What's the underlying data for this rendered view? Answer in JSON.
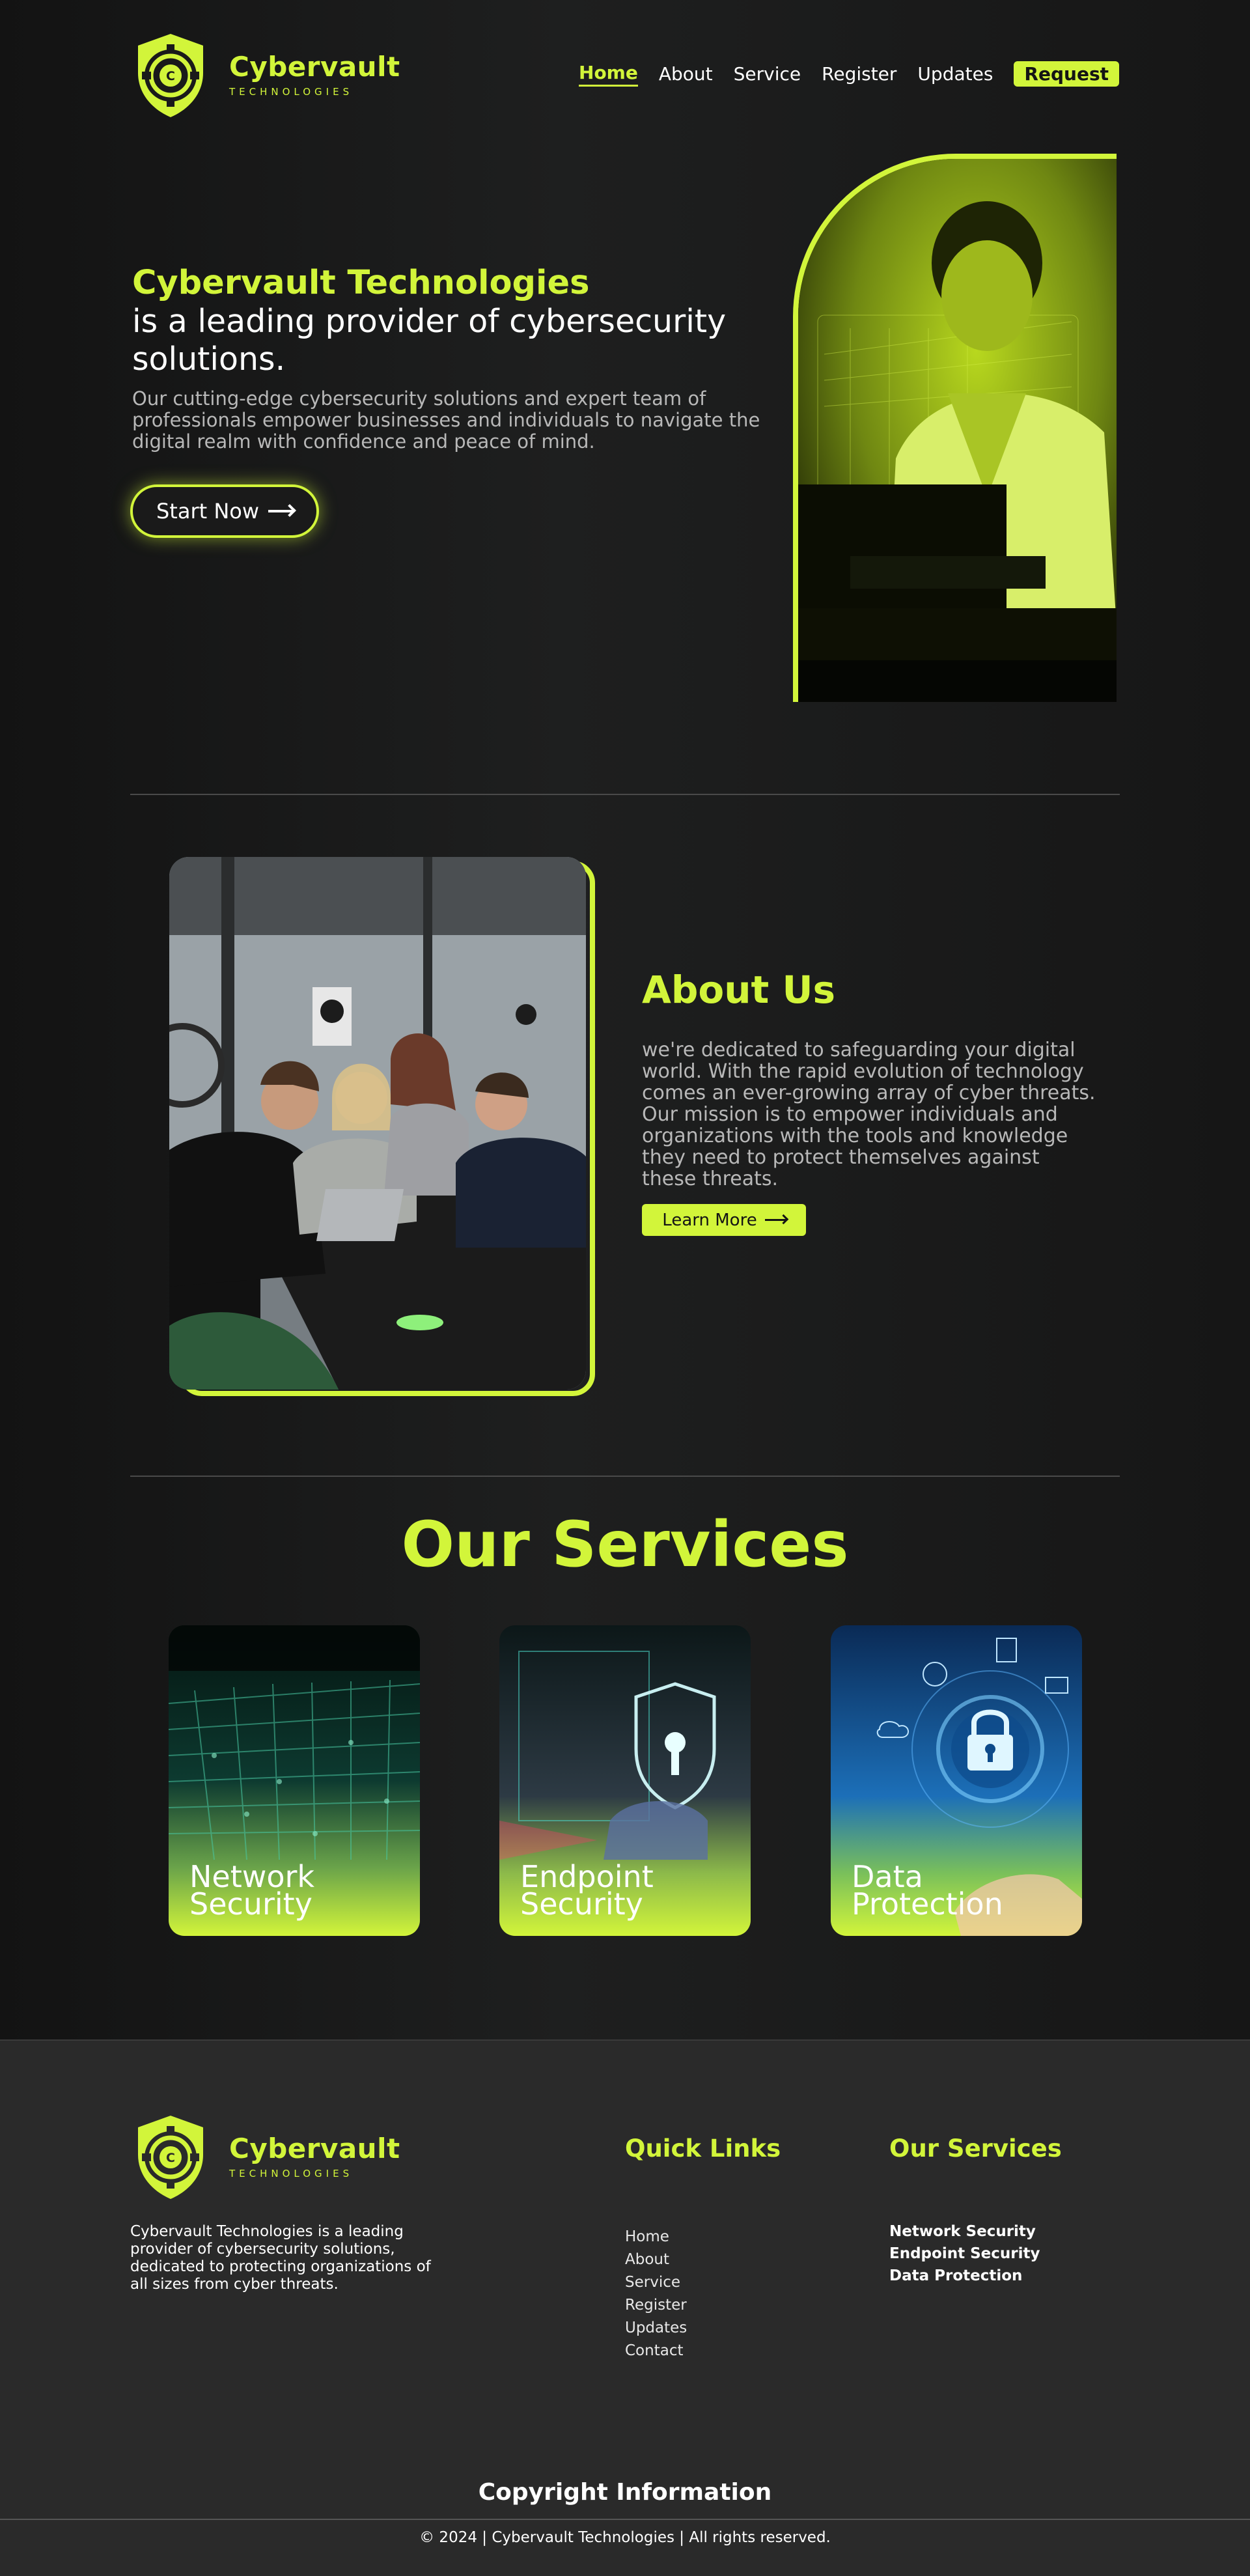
{
  "brand": {
    "name": "Cybervault",
    "tagline": "TECHNOLOGIES",
    "accent": "#d2f53a",
    "background": "#1a1a1a"
  },
  "nav": {
    "items": [
      "Home",
      "About",
      "Service",
      "Register",
      "Updates"
    ],
    "active": "Home",
    "request_label": "Request"
  },
  "hero": {
    "title": "Cybervault Technologies",
    "subtitle": "is a leading provider of cybersecurity solutions.",
    "description": "Our cutting-edge cybersecurity solutions and expert team of professionals empower businesses and individuals to navigate the digital realm with confidence and peace of mind.",
    "cta_label": "Start Now"
  },
  "about": {
    "title": "About Us",
    "text": "we're dedicated to safeguarding your digital world. With the rapid evolution of technology comes an ever-growing array of cyber threats. Our mission is to empower individuals and organizations with the tools and knowledge they need to protect themselves against these threats.",
    "cta_label": "Learn More"
  },
  "services": {
    "title": "Our Services",
    "cards": [
      {
        "label": "Network Security",
        "icon": "circuit-board-image"
      },
      {
        "label": "Endpoint Security",
        "icon": "shield-lock-image"
      },
      {
        "label": "Data Protection",
        "icon": "padlock-image"
      }
    ]
  },
  "footer": {
    "description": "Cybervault Technologies is a leading provider of cybersecurity solutions, dedicated to protecting organizations of all sizes from cyber threats.",
    "quick_links_title": "Quick Links",
    "quick_links": [
      "Home",
      "About",
      "Service",
      "Register",
      "Updates",
      "Contact"
    ],
    "services_title": "Our Services",
    "services": [
      "Network Security",
      "Endpoint Security",
      "Data Protection"
    ],
    "copyright_title": "Copyright Information",
    "copyright_text": "© 2024 | Cybervault Technologies | All rights reserved."
  }
}
